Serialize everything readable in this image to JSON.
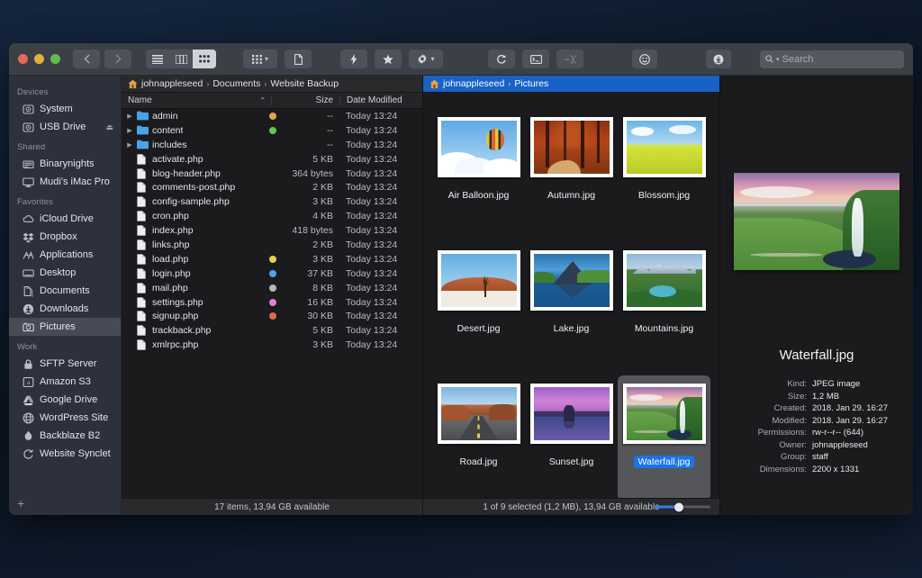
{
  "window": {
    "traffic_lights": [
      "close",
      "minimize",
      "zoom"
    ],
    "colors": {
      "accent": "#1a73e8",
      "crumb_active_bg": "#1762c4",
      "sidebar_bg": "#2c313c",
      "pane_bg": "#1b1b1d"
    }
  },
  "toolbar": {
    "back_label": "‹",
    "forward_label": "›",
    "view_modes": [
      {
        "name": "list-view",
        "active": false
      },
      {
        "name": "column-view",
        "active": false
      },
      {
        "name": "icon-view",
        "active": true
      }
    ],
    "buttons": [
      {
        "name": "group-by-button",
        "icon": "grid-icon",
        "caret": true
      },
      {
        "name": "new-document-button",
        "icon": "document-icon",
        "caret": false
      },
      {
        "name": "quick-action-button",
        "icon": "bolt-icon",
        "caret": false
      },
      {
        "name": "favorites-button",
        "icon": "star-icon",
        "caret": false
      },
      {
        "name": "settings-button",
        "icon": "gear-icon",
        "caret": true
      },
      {
        "name": "refresh-button",
        "icon": "refresh-icon",
        "caret": false
      },
      {
        "name": "terminal-button",
        "icon": "terminal-icon",
        "caret": false
      },
      {
        "name": "compare-button",
        "icon": "compare-icon",
        "caret": false
      },
      {
        "name": "tag-button",
        "icon": "smiley-icon",
        "caret": false
      },
      {
        "name": "download-button",
        "icon": "download-icon",
        "caret": false
      }
    ],
    "search": {
      "placeholder": "Search",
      "value": "",
      "icon": "search-icon"
    }
  },
  "sidebar": {
    "sections": [
      {
        "title": "Devices",
        "items": [
          {
            "label": "System",
            "icon": "hard-drive-icon",
            "selected": false,
            "eject": false
          },
          {
            "label": "USB Drive",
            "icon": "hard-drive-icon",
            "selected": false,
            "eject": true
          }
        ]
      },
      {
        "title": "Shared",
        "items": [
          {
            "label": "Binarynights",
            "icon": "server-icon",
            "selected": false,
            "eject": false
          },
          {
            "label": "Mudi's iMac Pro",
            "icon": "imac-icon",
            "selected": false,
            "eject": false
          }
        ]
      },
      {
        "title": "Favorites",
        "items": [
          {
            "label": "iCloud Drive",
            "icon": "cloud-icon",
            "selected": false,
            "eject": false
          },
          {
            "label": "Dropbox",
            "icon": "dropbox-icon",
            "selected": false,
            "eject": false
          },
          {
            "label": "Applications",
            "icon": "applications-icon",
            "selected": false,
            "eject": false
          },
          {
            "label": "Desktop",
            "icon": "desktop-icon",
            "selected": false,
            "eject": false
          },
          {
            "label": "Documents",
            "icon": "documents-icon",
            "selected": false,
            "eject": false
          },
          {
            "label": "Downloads",
            "icon": "downloads-icon",
            "selected": false,
            "eject": false
          },
          {
            "label": "Pictures",
            "icon": "pictures-icon",
            "selected": true,
            "eject": false
          }
        ]
      },
      {
        "title": "Work",
        "items": [
          {
            "label": "SFTP Server",
            "icon": "lock-icon",
            "selected": false,
            "eject": false
          },
          {
            "label": "Amazon S3",
            "icon": "amazon-icon",
            "selected": false,
            "eject": false
          },
          {
            "label": "Google Drive",
            "icon": "google-drive-icon",
            "selected": false,
            "eject": false
          },
          {
            "label": "WordPress Site",
            "icon": "globe-icon",
            "selected": false,
            "eject": false
          },
          {
            "label": "Backblaze B2",
            "icon": "flame-icon",
            "selected": false,
            "eject": false
          },
          {
            "label": "Website Synclet",
            "icon": "sync-icon",
            "selected": false,
            "eject": false
          }
        ]
      }
    ],
    "add_button_label": "+"
  },
  "list_pane": {
    "breadcrumb": {
      "home_icon": "home-icon",
      "crumbs": [
        "johnappleseed",
        "Documents",
        "Website Backup"
      ],
      "separator": "›",
      "active": false
    },
    "columns": [
      {
        "key": "name",
        "label": "Name",
        "sorted": true,
        "sort_indicator": "⌃"
      },
      {
        "key": "size",
        "label": "Size"
      },
      {
        "key": "date",
        "label": "Date Modified"
      }
    ],
    "rows": [
      {
        "name": "admin",
        "type": "folder",
        "tag": "#e8a24a",
        "size": "--",
        "date": "Today 13:24"
      },
      {
        "name": "content",
        "type": "folder",
        "tag": "#66c45a",
        "size": "--",
        "date": "Today 13:24"
      },
      {
        "name": "includes",
        "type": "folder",
        "tag": null,
        "size": "--",
        "date": "Today 13:24"
      },
      {
        "name": "activate.php",
        "type": "file",
        "tag": null,
        "size": "5 KB",
        "date": "Today 13:24"
      },
      {
        "name": "blog-header.php",
        "type": "file",
        "tag": null,
        "size": "364 bytes",
        "date": "Today 13:24"
      },
      {
        "name": "comments-post.php",
        "type": "file",
        "tag": null,
        "size": "2 KB",
        "date": "Today 13:24"
      },
      {
        "name": "config-sample.php",
        "type": "file",
        "tag": null,
        "size": "3 KB",
        "date": "Today 13:24"
      },
      {
        "name": "cron.php",
        "type": "file",
        "tag": null,
        "size": "4 KB",
        "date": "Today 13:24"
      },
      {
        "name": "index.php",
        "type": "file",
        "tag": null,
        "size": "418 bytes",
        "date": "Today 13:24"
      },
      {
        "name": "links.php",
        "type": "file",
        "tag": null,
        "size": "2 KB",
        "date": "Today 13:24"
      },
      {
        "name": "load.php",
        "type": "file",
        "tag": "#e8d04a",
        "size": "3 KB",
        "date": "Today 13:24"
      },
      {
        "name": "login.php",
        "type": "file",
        "tag": "#4aa8e8",
        "size": "37 KB",
        "date": "Today 13:24"
      },
      {
        "name": "mail.php",
        "type": "file",
        "tag": "#b3b6ba",
        "size": "8 KB",
        "date": "Today 13:24"
      },
      {
        "name": "settings.php",
        "type": "file",
        "tag": "#e07fd6",
        "size": "16 KB",
        "date": "Today 13:24"
      },
      {
        "name": "signup.php",
        "type": "file",
        "tag": "#e06a4a",
        "size": "30 KB",
        "date": "Today 13:24"
      },
      {
        "name": "trackback.php",
        "type": "file",
        "tag": null,
        "size": "5 KB",
        "date": "Today 13:24"
      },
      {
        "name": "xmlrpc.php",
        "type": "file",
        "tag": null,
        "size": "3 KB",
        "date": "Today 13:24"
      }
    ],
    "status": "17 items, 13,94 GB available"
  },
  "grid_pane": {
    "breadcrumb": {
      "home_icon": "home-icon",
      "crumbs": [
        "johnappleseed",
        "Pictures"
      ],
      "separator": "›",
      "active": true
    },
    "items": [
      {
        "label": "Air Balloon.jpg",
        "art": "a-balloon",
        "selected": false
      },
      {
        "label": "Autumn.jpg",
        "art": "a-autumn",
        "selected": false
      },
      {
        "label": "Blossom.jpg",
        "art": "a-blossom",
        "selected": false
      },
      {
        "label": "Desert.jpg",
        "art": "a-desert",
        "selected": false
      },
      {
        "label": "Lake.jpg",
        "art": "a-lake",
        "selected": false
      },
      {
        "label": "Mountains.jpg",
        "art": "a-mount",
        "selected": false
      },
      {
        "label": "Road.jpg",
        "art": "a-road",
        "selected": false
      },
      {
        "label": "Sunset.jpg",
        "art": "a-sunset",
        "selected": false
      },
      {
        "label": "Waterfall.jpg",
        "art": "a-fall",
        "selected": true
      }
    ],
    "status": "1 of 9 selected (1,2 MB), 13,94 GB available",
    "zoom_slider": {
      "name": "icon-size-slider",
      "value": 44
    }
  },
  "info_pane": {
    "preview_art": "a-fall",
    "title": "Waterfall.jpg",
    "fields": [
      {
        "key": "Kind:",
        "value": "JPEG image"
      },
      {
        "key": "Size:",
        "value": "1,2 MB"
      },
      {
        "key": "Created:",
        "value": "2018. Jan 29. 16:27"
      },
      {
        "key": "Modified:",
        "value": "2018. Jan 29. 16:27"
      },
      {
        "key": "Permissions:",
        "value": "rw-r--r-- (644)"
      },
      {
        "key": "Owner:",
        "value": "johnappleseed"
      },
      {
        "key": "Group:",
        "value": "staff"
      },
      {
        "key": "Dimensions:",
        "value": "2200 x 1331"
      }
    ]
  }
}
